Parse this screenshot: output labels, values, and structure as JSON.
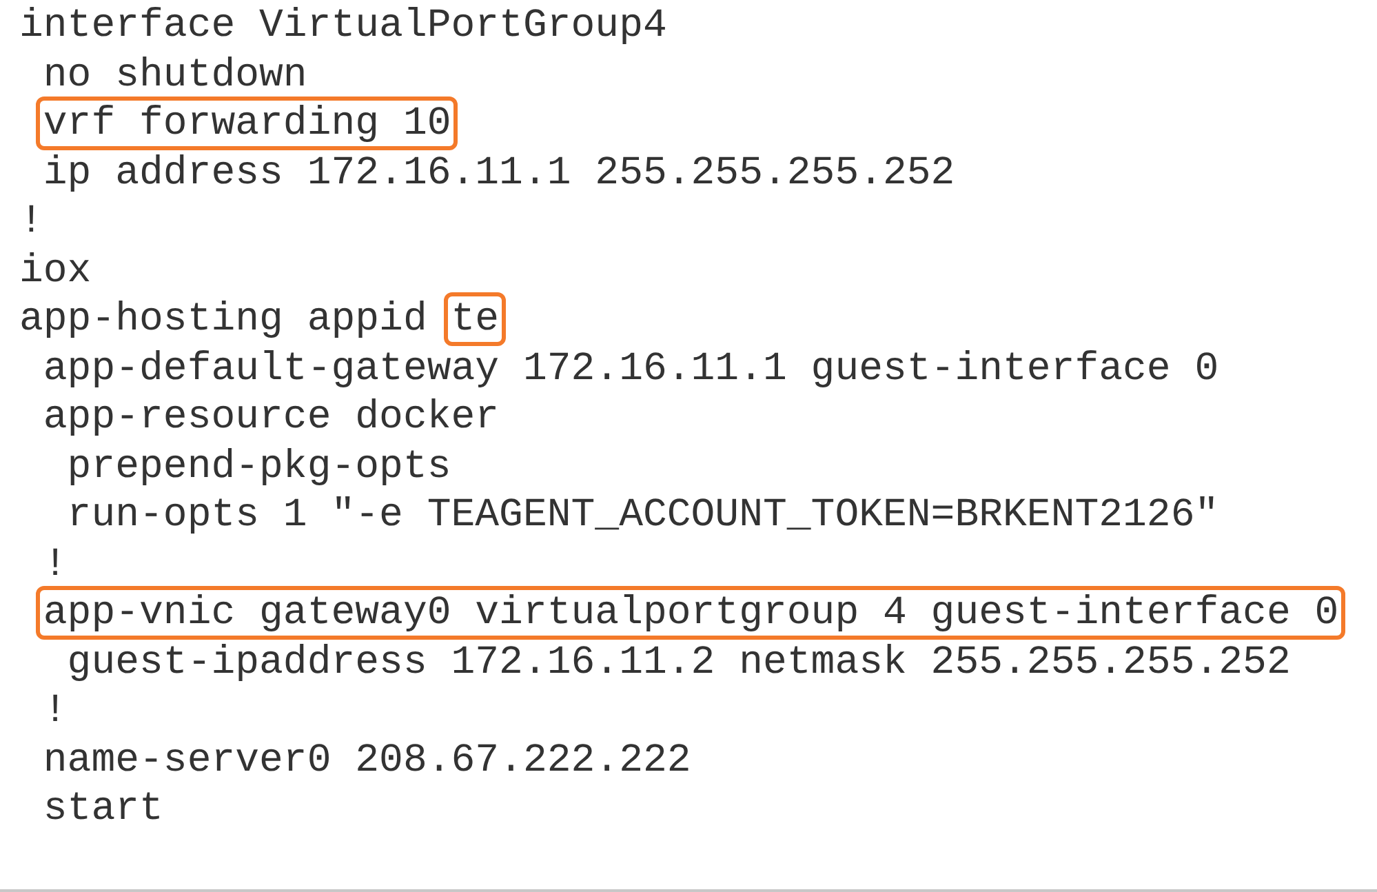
{
  "lines": [
    {
      "segments": [
        {
          "text": "interface VirtualPortGroup4",
          "highlighted": false
        }
      ]
    },
    {
      "segments": [
        {
          "text": " no shutdown",
          "highlighted": false
        }
      ]
    },
    {
      "segments": [
        {
          "text": " vrf forwarding 10",
          "highlighted": true
        }
      ]
    },
    {
      "segments": [
        {
          "text": " ip address 172.16.11.1 255.255.255.252",
          "highlighted": false
        }
      ]
    },
    {
      "segments": [
        {
          "text": "!",
          "highlighted": false
        }
      ]
    },
    {
      "segments": [
        {
          "text": "iox",
          "highlighted": false
        }
      ]
    },
    {
      "segments": [
        {
          "text": "app-hosting appid ",
          "highlighted": false
        },
        {
          "text": "te",
          "highlighted": true
        }
      ]
    },
    {
      "segments": [
        {
          "text": " app-default-gateway 172.16.11.1 guest-interface 0",
          "highlighted": false
        }
      ]
    },
    {
      "segments": [
        {
          "text": " app-resource docker",
          "highlighted": false
        }
      ]
    },
    {
      "segments": [
        {
          "text": "  prepend-pkg-opts",
          "highlighted": false
        }
      ]
    },
    {
      "segments": [
        {
          "text": "  run-opts 1 \"-e TEAGENT_ACCOUNT_TOKEN=BRKENT2126\"",
          "highlighted": false
        }
      ]
    },
    {
      "segments": [
        {
          "text": " !",
          "highlighted": false
        }
      ]
    },
    {
      "segments": [
        {
          "text": " app-vnic gateway0 virtualportgroup 4 guest-interface 0",
          "highlighted": true
        }
      ]
    },
    {
      "segments": [
        {
          "text": "  guest-ipaddress 172.16.11.2 netmask 255.255.255.252",
          "highlighted": false
        }
      ]
    },
    {
      "segments": [
        {
          "text": " !",
          "highlighted": false
        }
      ]
    },
    {
      "segments": [
        {
          "text": " name-server0 208.67.222.222",
          "highlighted": false
        }
      ]
    },
    {
      "segments": [
        {
          "text": " start",
          "highlighted": false
        }
      ]
    }
  ]
}
